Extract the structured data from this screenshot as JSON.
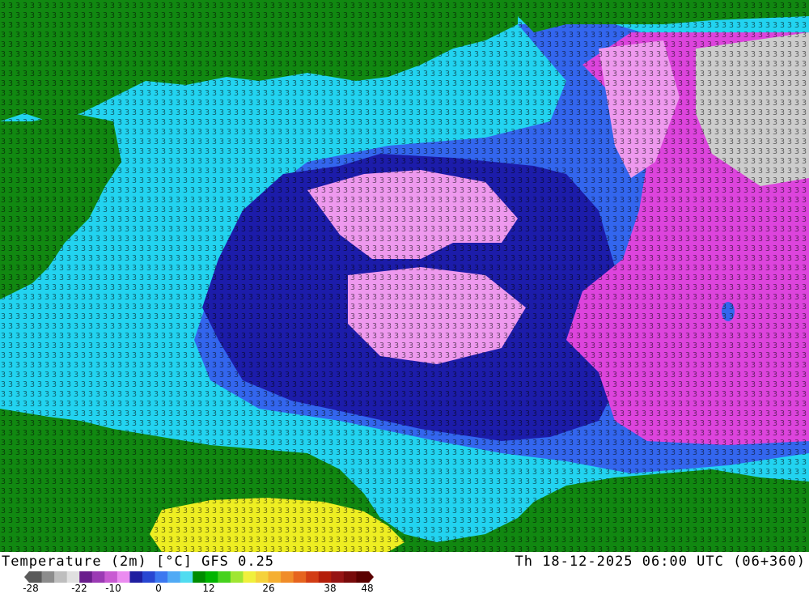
{
  "header": {
    "title": "Temperature (2m) [°C] GFS 0.25",
    "valid_time": "Th 18-12-2025 06:00 UTC (06+360)"
  },
  "legend": {
    "tick_labels": [
      "-28",
      "-22",
      "-10",
      "0",
      "12",
      "26",
      "38",
      "48"
    ],
    "colors": [
      "#5a5a5a",
      "#8c8c8c",
      "#bebebe",
      "#e0e0e0",
      "#6a1e8c",
      "#9b3ab4",
      "#c85ad2",
      "#eb8cf0",
      "#1e1ea0",
      "#2846d2",
      "#3c78f0",
      "#50aaf5",
      "#50dcf0",
      "#008c00",
      "#00b400",
      "#46d21e",
      "#a0e632",
      "#f0f03c",
      "#f5d23c",
      "#f5af32",
      "#f08c28",
      "#e6641e",
      "#d23c14",
      "#b41e0a",
      "#961414",
      "#780a0a",
      "#5a0000"
    ]
  },
  "map": {
    "colors": {
      "land_green": "#118811",
      "sea_cyan": "#22d3f0",
      "sea_mid_blue": "#3366ee",
      "sea_deep_blue": "#1c1caa",
      "sea_violet": "#ee99ee",
      "sea_magenta": "#dd44dd",
      "land_yellow": "#eeee22",
      "land_grey": "#cccccc"
    }
  }
}
